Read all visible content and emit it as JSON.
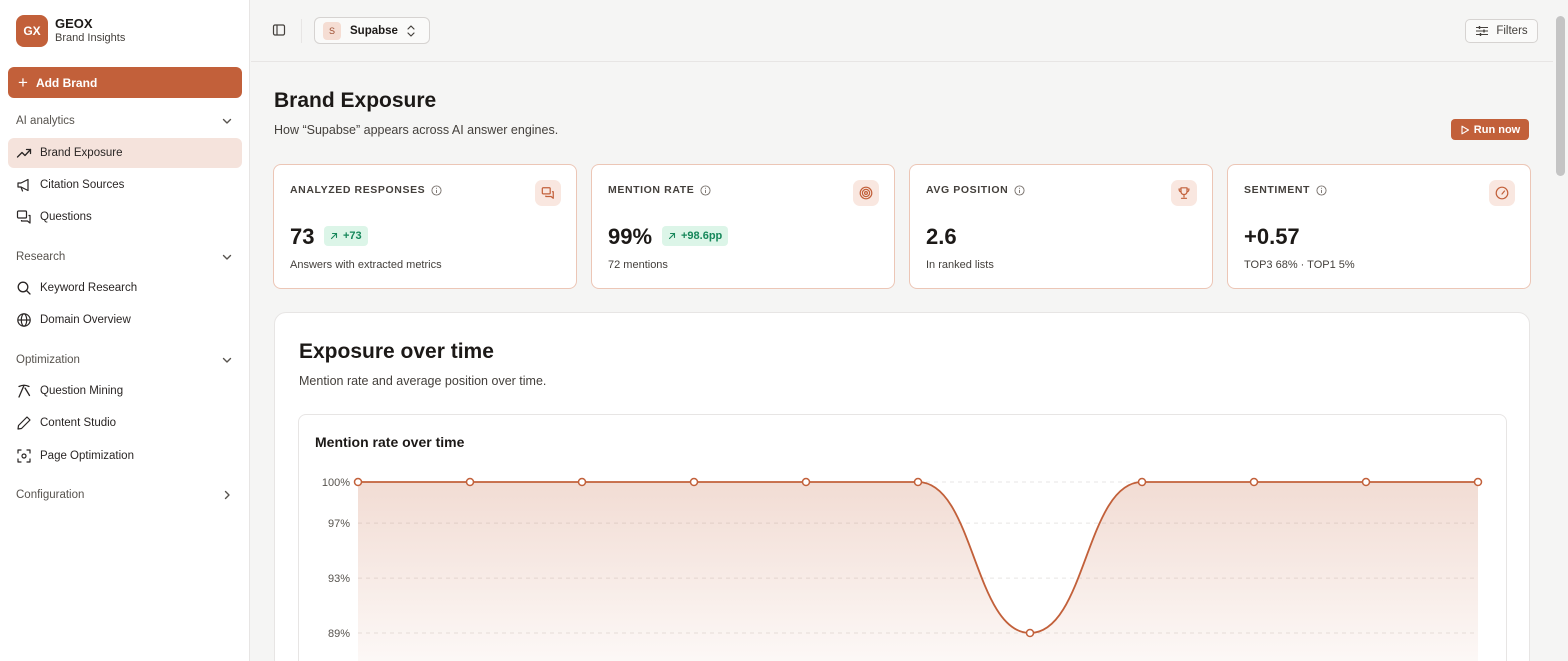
{
  "sidebar": {
    "logo_text": "GX",
    "app_name": "GEOX",
    "app_subtitle": "Brand Insights",
    "add_brand_label": "Add Brand",
    "sections": {
      "ai": "AI analytics",
      "research": "Research",
      "optimization": "Optimization",
      "configuration": "Configuration"
    },
    "items": {
      "brand_exposure": "Brand Exposure",
      "citation_sources": "Citation Sources",
      "questions": "Questions",
      "keyword_research": "Keyword Research",
      "domain_overview": "Domain Overview",
      "question_mining": "Question Mining",
      "content_studio": "Content Studio",
      "page_optimization": "Page Optimization"
    }
  },
  "topbar": {
    "brand_badge": "S",
    "brand_selected": "Supabse",
    "filters_label": "Filters"
  },
  "page": {
    "title": "Brand Exposure",
    "subtitle": "How “Supabse” appears across AI answer engines.",
    "run_now_label": "Run now"
  },
  "cards": [
    {
      "label": "ANALYZED RESPONSES",
      "value": "73",
      "delta": "+73",
      "caption": "Answers with extracted metrics",
      "icon": "messages-icon"
    },
    {
      "label": "MENTION RATE",
      "value": "99%",
      "delta": "+98.6pp",
      "caption": "72 mentions",
      "icon": "target-icon"
    },
    {
      "label": "AVG POSITION",
      "value": "2.6",
      "delta": "",
      "caption": "In ranked lists",
      "icon": "trophy-icon"
    },
    {
      "label": "SENTIMENT",
      "value": "+0.57",
      "delta": "",
      "caption": "TOP3 68% · TOP1 5%",
      "icon": "gauge-icon"
    }
  ],
  "exposure": {
    "title": "Exposure over time",
    "subtitle": "Mention rate and average position over time."
  },
  "colors": {
    "accent": "#c2603a",
    "active_bg": "#f5e3dc",
    "delta_bg": "#dcf5e8",
    "delta_text": "#16875a"
  },
  "chart_data": {
    "type": "area",
    "title": "Mention rate over time",
    "y_ticks": [
      "100%",
      "97%",
      "93%",
      "89%"
    ],
    "ylim": [
      88,
      100
    ],
    "grid": true,
    "series": [
      {
        "values": [
          100,
          100,
          100,
          100,
          100,
          100,
          89,
          100,
          100,
          100,
          100
        ]
      }
    ],
    "line_color": "#c2603a"
  }
}
